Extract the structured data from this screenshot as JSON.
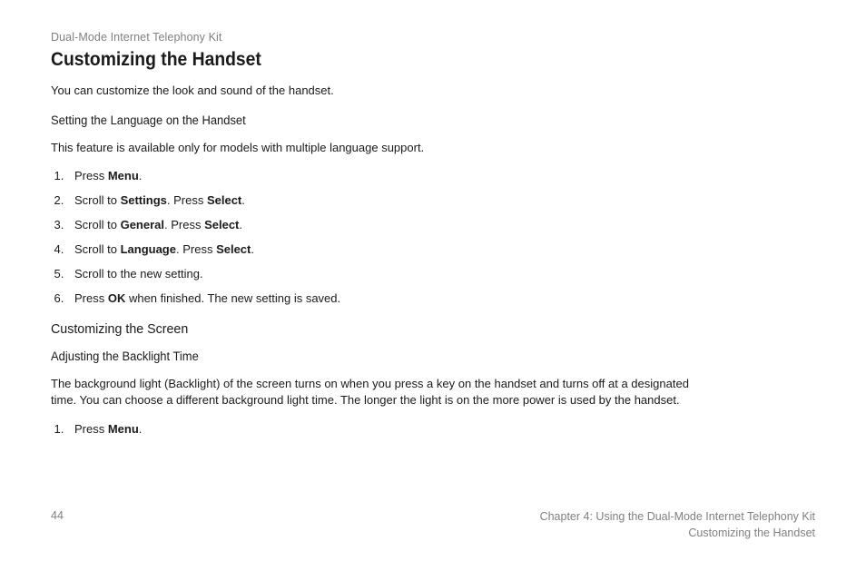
{
  "header": {
    "product": "Dual-Mode Internet Telephony Kit"
  },
  "title": "Customizing the Handset",
  "intro": "You can customize the look and sound of the handset.",
  "section1": {
    "heading": "Setting the Language on the Handset",
    "note": "This feature is available only for models with multiple language support.",
    "steps": [
      {
        "pre": "Press ",
        "bold1": "Menu",
        "mid": "",
        "bold2": "",
        "post": "."
      },
      {
        "pre": "Scroll to ",
        "bold1": "Settings",
        "mid": ". Press ",
        "bold2": "Select",
        "post": "."
      },
      {
        "pre": "Scroll to ",
        "bold1": "General",
        "mid": ". Press ",
        "bold2": "Select",
        "post": "."
      },
      {
        "pre": "Scroll to ",
        "bold1": "Language",
        "mid": ". Press ",
        "bold2": "Select",
        "post": "."
      },
      {
        "pre": "Scroll to the new setting.",
        "bold1": "",
        "mid": "",
        "bold2": "",
        "post": ""
      },
      {
        "pre": "Press ",
        "bold1": "OK",
        "mid": " when finished. The new setting is saved.",
        "bold2": "",
        "post": ""
      }
    ]
  },
  "section2": {
    "heading": "Customizing the Screen",
    "sub": {
      "heading": "Adjusting the Backlight Time",
      "para": "The background light (Backlight) of the screen turns on when you press a key on the handset and turns off at a designated time. You can choose a different background light time. The longer the light is on the more power is used by the handset.",
      "steps": [
        {
          "pre": "Press ",
          "bold1": "Menu",
          "mid": "",
          "bold2": "",
          "post": "."
        }
      ]
    }
  },
  "footer": {
    "page": "44",
    "chapter": "Chapter 4: Using the Dual-Mode Internet Telephony Kit",
    "section": "Customizing the Handset"
  }
}
